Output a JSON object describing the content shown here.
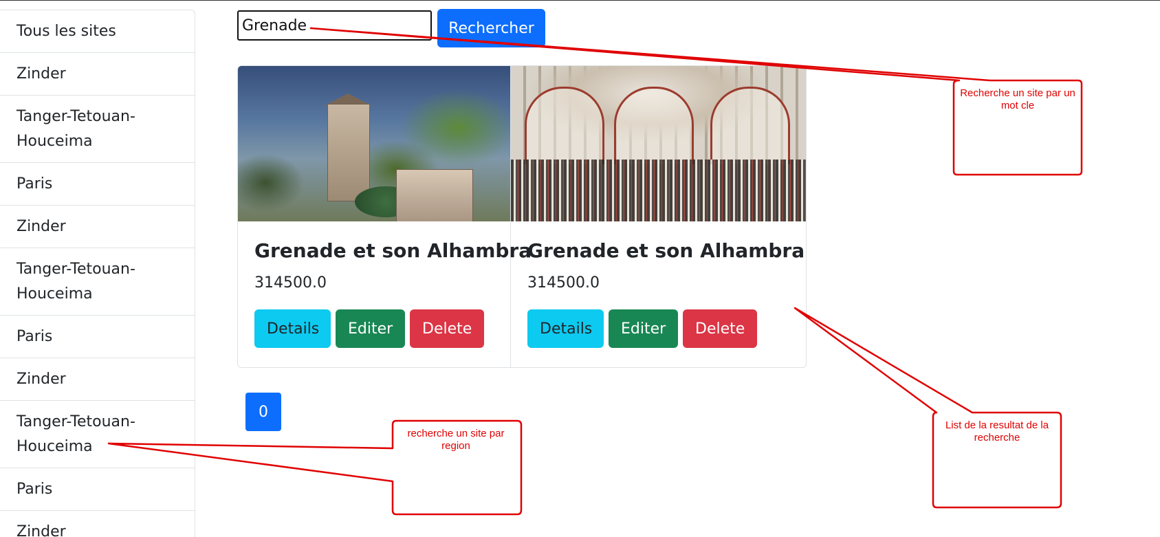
{
  "search": {
    "value": "Grenade",
    "button_label": "Rechercher"
  },
  "sidebar": {
    "items": [
      {
        "label": "Tous les sites"
      },
      {
        "label": "Zinder"
      },
      {
        "label": "Tanger-Tetouan-Houceima"
      },
      {
        "label": "Paris"
      },
      {
        "label": "Zinder"
      },
      {
        "label": "Tanger-Tetouan-Houceima"
      },
      {
        "label": "Paris"
      },
      {
        "label": "Zinder"
      },
      {
        "label": "Tanger-Tetouan-Houceima"
      },
      {
        "label": "Paris"
      },
      {
        "label": "Zinder"
      }
    ]
  },
  "cards": [
    {
      "title": "Grenade et son Alhambra",
      "price": "314500.0",
      "details_label": "Details",
      "edit_label": "Editer",
      "delete_label": "Delete"
    },
    {
      "title": "Grenade et son Alhambra",
      "price": "314500.0",
      "details_label": "Details",
      "edit_label": "Editer",
      "delete_label": "Delete"
    }
  ],
  "pagination": {
    "current_page": "0"
  },
  "annotations": {
    "search": "Recherche un site par un mot cle",
    "results": "List de la resultat de la recherche",
    "region": "recherche un site par region"
  },
  "colors": {
    "primary": "#0d6efd",
    "info": "#0dcaf0",
    "success": "#198754",
    "danger": "#dc3545",
    "annotation": "#e00000"
  }
}
